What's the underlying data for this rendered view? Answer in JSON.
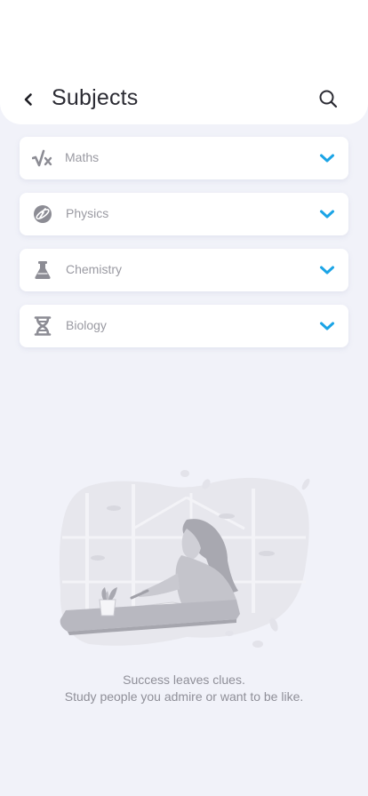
{
  "header": {
    "title": "Subjects",
    "back_icon": "chevron-left-icon",
    "search_icon": "search-icon"
  },
  "subjects": [
    {
      "label": "Maths",
      "icon": "square-root-icon"
    },
    {
      "label": "Physics",
      "icon": "atom-icon"
    },
    {
      "label": "Chemistry",
      "icon": "flask-icon"
    },
    {
      "label": "Biology",
      "icon": "dna-icon"
    }
  ],
  "quote": {
    "line1": "Success leaves clues.",
    "line2": "Study people you admire or want to be like."
  },
  "colors": {
    "background": "#f1f2f9",
    "card": "#ffffff",
    "accent": "#1ba4e6",
    "icon": "#8c8c94",
    "text_muted": "#9a9aa2"
  }
}
